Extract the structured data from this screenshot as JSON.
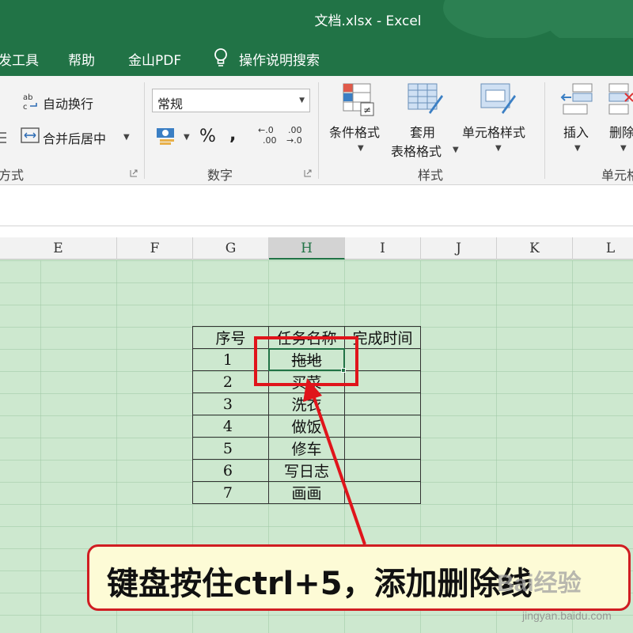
{
  "window": {
    "title": "文档.xlsx  -  Excel",
    "accent": "#217346"
  },
  "menu": {
    "items": [
      "发工具",
      "帮助",
      "金山PDF"
    ],
    "tell_me": "操作说明搜索"
  },
  "ribbon": {
    "alignment": {
      "wrap_text": "自动换行",
      "merge_center": "合并后居中",
      "group_label": "方式"
    },
    "number": {
      "format_value": "常规",
      "percent": "%",
      "comma": ",",
      "inc_decimal": [
        "←.0",
        ".00"
      ],
      "dec_decimal": [
        ".00",
        "→.0"
      ],
      "group_label": "数字"
    },
    "styles": {
      "conditional": "条件格式",
      "table_format_1": "套用",
      "table_format_2": "表格格式",
      "cell_styles": "单元格样式",
      "group_label": "样式"
    },
    "cells": {
      "insert": "插入",
      "delete": "删除",
      "group_label": "单元格"
    }
  },
  "columns": [
    "E",
    "F",
    "G",
    "H",
    "I",
    "J",
    "K",
    "L"
  ],
  "selected_column": "H",
  "table": {
    "headers": [
      "序号",
      "任务名称",
      "完成时间"
    ],
    "rows": [
      {
        "seq": "1",
        "task": "拖地",
        "time": ""
      },
      {
        "seq": "2",
        "task": "买菜",
        "time": ""
      },
      {
        "seq": "3",
        "task": "洗衣",
        "time": ""
      },
      {
        "seq": "4",
        "task": "做饭",
        "time": ""
      },
      {
        "seq": "5",
        "task": "修车",
        "time": ""
      },
      {
        "seq": "6",
        "task": "写日志",
        "time": ""
      },
      {
        "seq": "7",
        "task": "画画",
        "time": ""
      }
    ],
    "struck_row": 0
  },
  "annotation": {
    "callout": "键盘按住ctrl+5，添加删除线",
    "color": "#e0141b"
  },
  "watermark": {
    "logo": "Bai经验",
    "url": "jingyan.baidu.com"
  }
}
